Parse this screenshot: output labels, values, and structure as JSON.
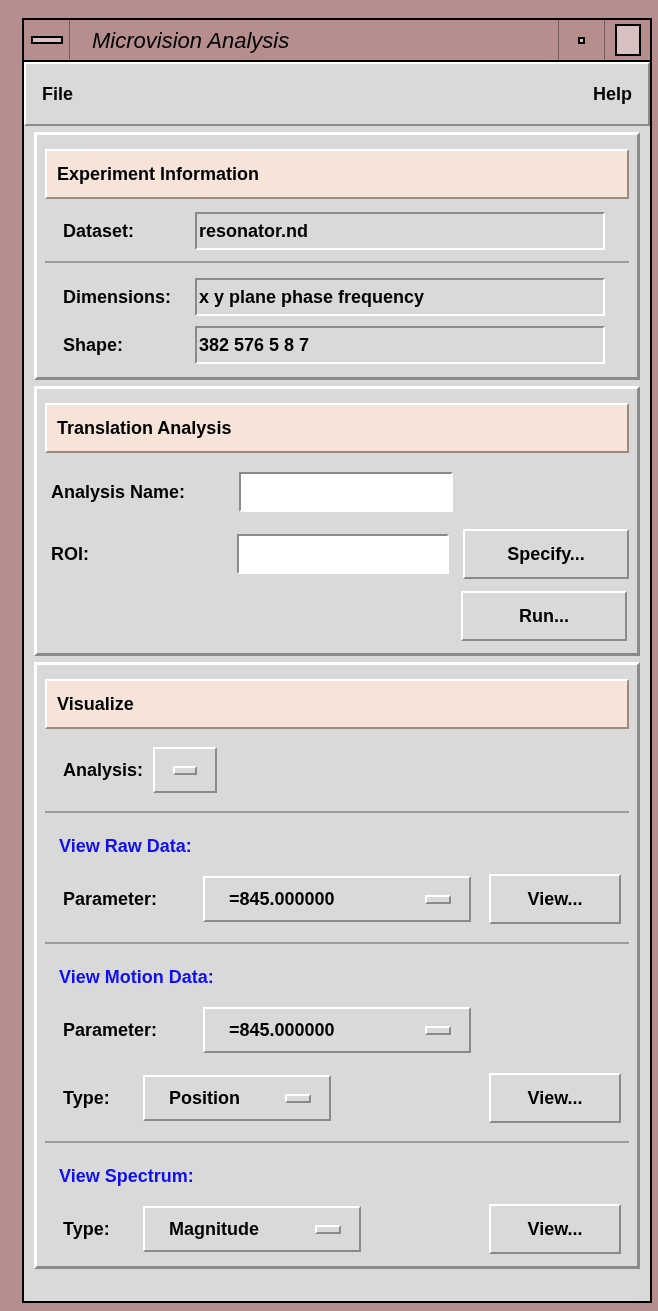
{
  "window": {
    "title": "Microvision Analysis"
  },
  "menu": [
    {
      "label": "File"
    },
    {
      "label": "Help"
    }
  ],
  "experiment": {
    "title": "Experiment Information",
    "groups": [
      [
        {
          "label": "Dataset:",
          "value": "resonator.nd"
        }
      ],
      [
        {
          "label": "Dimensions:",
          "value": "x y plane phase frequency"
        },
        {
          "label": "Shape:",
          "value": "382 576 5 8 7"
        }
      ]
    ]
  },
  "translation": {
    "title": "Translation Analysis",
    "fields": [
      {
        "label": "Analysis Name:"
      },
      {
        "label": "ROI:",
        "button": "Specify..."
      }
    ],
    "buttons": [
      "Run..."
    ]
  },
  "visualize": {
    "title": "Visualize",
    "analysis": {
      "label": "Analysis:"
    },
    "sections": [
      {
        "heading": "View Raw Data:",
        "rows": [
          {
            "label": "Parameter:",
            "value": "=845.000000",
            "button": "View..."
          }
        ]
      },
      {
        "heading": "View Motion Data:",
        "rows": [
          {
            "label": "Parameter:",
            "value": "=845.000000"
          },
          {
            "label": "Type:",
            "value": "Position",
            "button": "View..."
          }
        ]
      },
      {
        "heading": "View Spectrum:",
        "rows": [
          {
            "label": "Type:",
            "value": "Magnitude",
            "button": "View..."
          }
        ]
      }
    ]
  }
}
